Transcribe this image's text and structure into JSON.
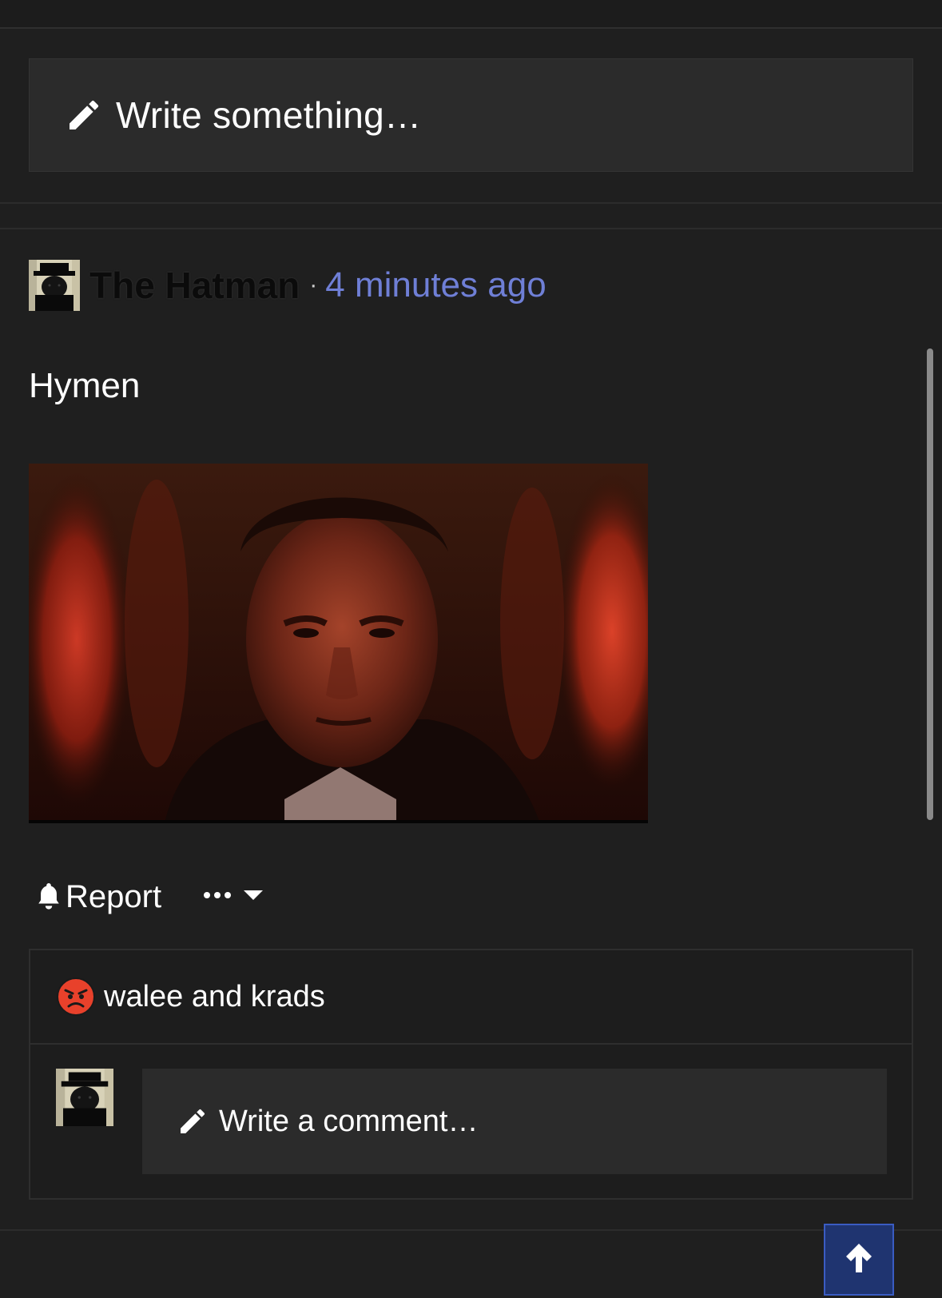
{
  "composer": {
    "placeholder": "Write something…",
    "icon": "pencil-icon"
  },
  "post": {
    "author": "The Hatman",
    "separator": "·",
    "time": "4 minutes ago",
    "body": "Hymen",
    "image": "embedded-photo"
  },
  "actions": {
    "report_label": "Report",
    "report_icon": "bell-icon",
    "more_icon": "ellipsis-icon",
    "dropdown_icon": "caret-down-icon"
  },
  "reactions": {
    "icon": "angry-face-icon",
    "text": "walee and krads"
  },
  "comment": {
    "placeholder": "Write a comment…",
    "icon": "pencil-icon"
  },
  "scroll_top": {
    "icon": "arrow-up-icon"
  },
  "colors": {
    "background": "#1f1f1f",
    "panel": "#2b2b2b",
    "link": "#6f7fd6",
    "scroll_button": "#1f3470"
  }
}
